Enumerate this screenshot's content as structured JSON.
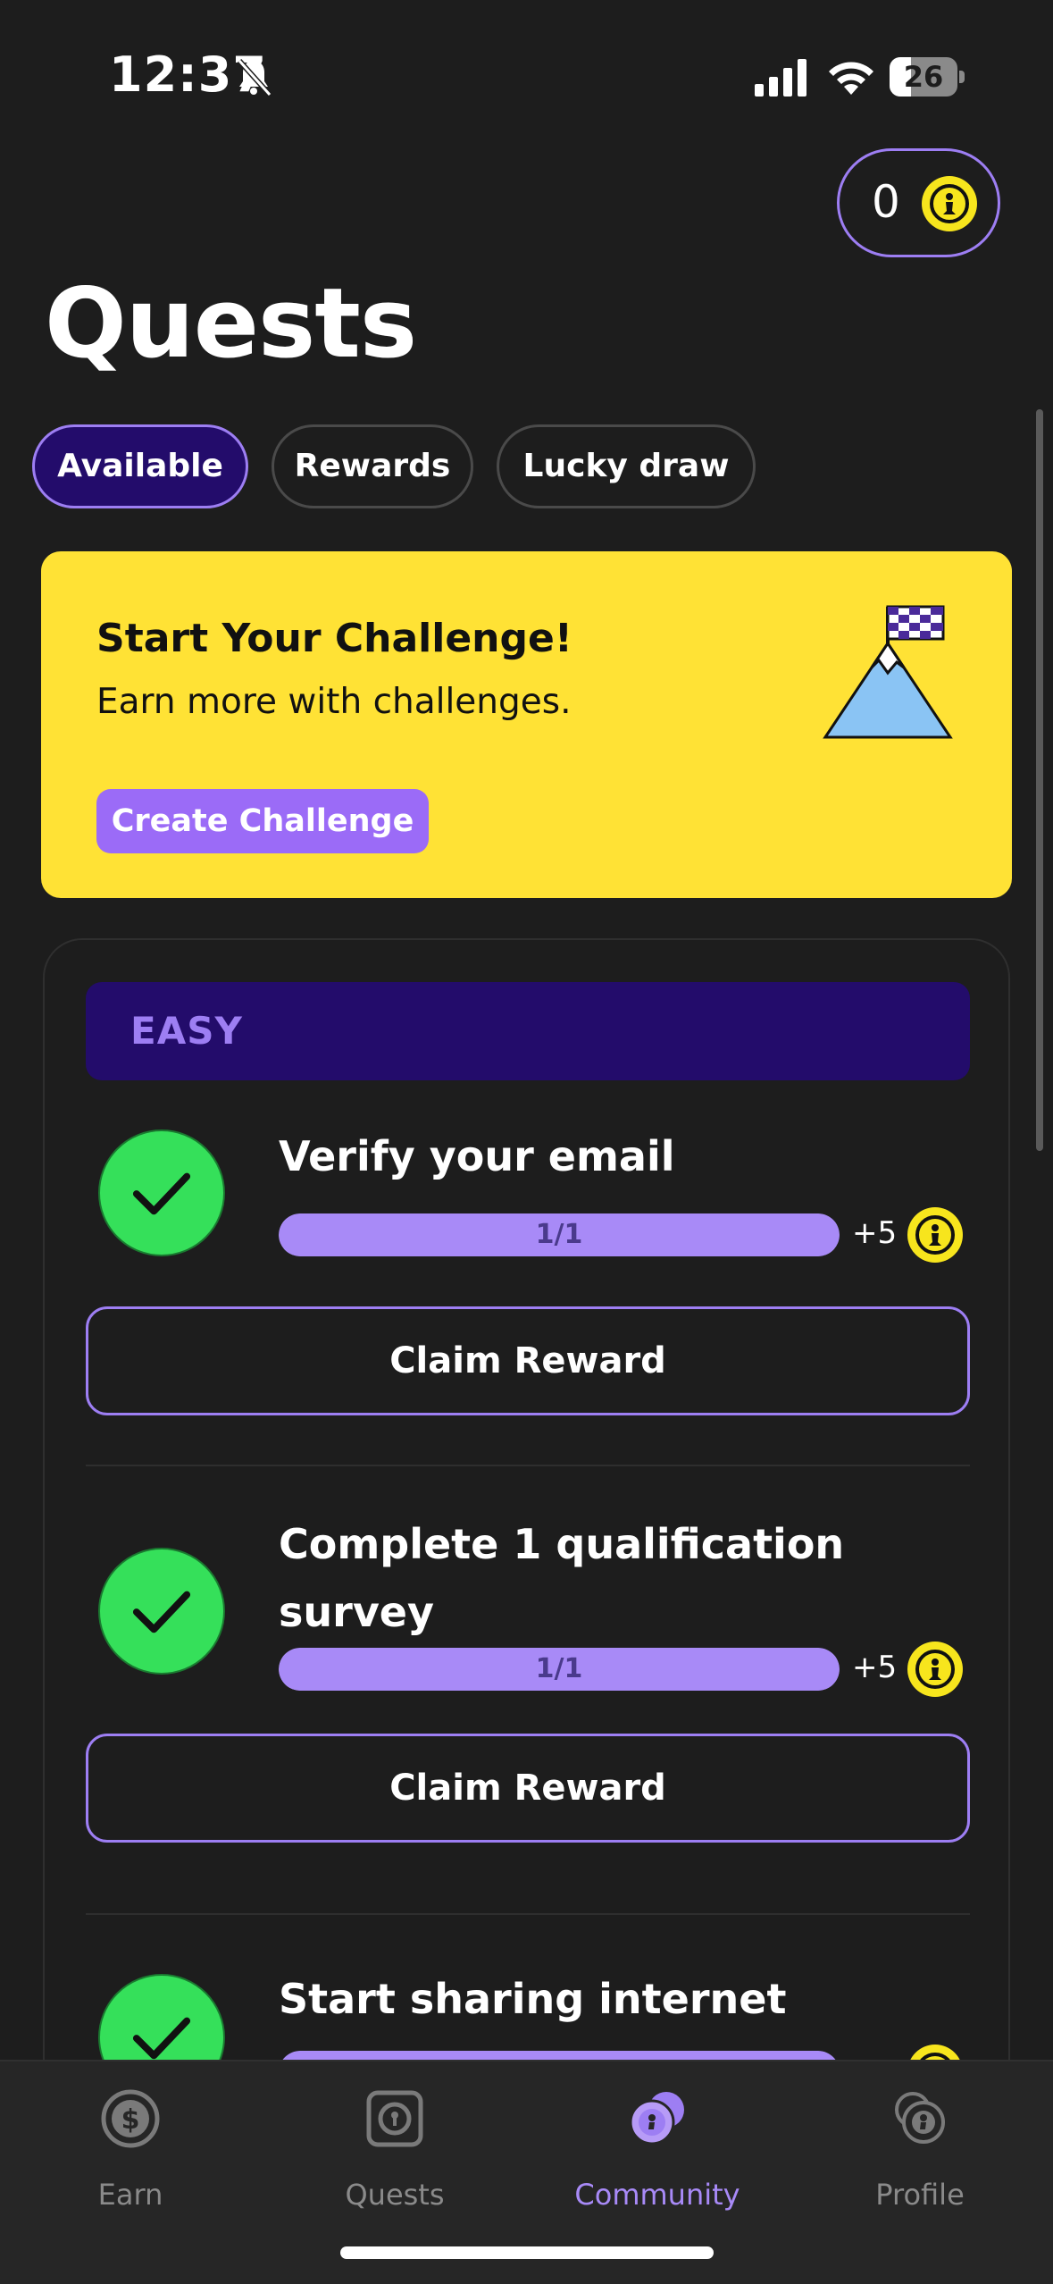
{
  "status_bar": {
    "time": "12:37",
    "battery": "26"
  },
  "balance": {
    "value": "0"
  },
  "page": {
    "title": "Quests"
  },
  "tabs": [
    {
      "label": "Available",
      "active": true
    },
    {
      "label": "Rewards",
      "active": false
    },
    {
      "label": "Lucky draw",
      "active": false
    }
  ],
  "challenge": {
    "title": "Start Your Challenge!",
    "subtitle": "Earn more with challenges.",
    "button_label": "Create Challenge"
  },
  "quests": {
    "level": "EASY",
    "items": [
      {
        "title": "Verify your email",
        "progress_label": "1/1",
        "progress": 1.0,
        "reward": "+5",
        "button_label": "Claim Reward",
        "completed": true
      },
      {
        "title": "Complete 1 qualification survey",
        "progress_label": "1/1",
        "progress": 1.0,
        "reward": "+5",
        "button_label": "Claim Reward",
        "completed": true
      },
      {
        "title": "Start sharing internet",
        "completed": true
      }
    ]
  },
  "nav": [
    {
      "label": "Earn",
      "icon": "dollar-coin-icon",
      "active": false
    },
    {
      "label": "Quests",
      "icon": "safe-lock-icon",
      "active": false
    },
    {
      "label": "Community",
      "icon": "community-coins-icon",
      "active": true
    },
    {
      "label": "Profile",
      "icon": "profile-coins-icon",
      "active": false
    }
  ],
  "colors": {
    "background": "#1d1d1d",
    "accent": "#9d7ef3",
    "challenge_bg": "#ffe235",
    "check_green": "#35e05a",
    "coin_yellow": "#f7e51d"
  }
}
